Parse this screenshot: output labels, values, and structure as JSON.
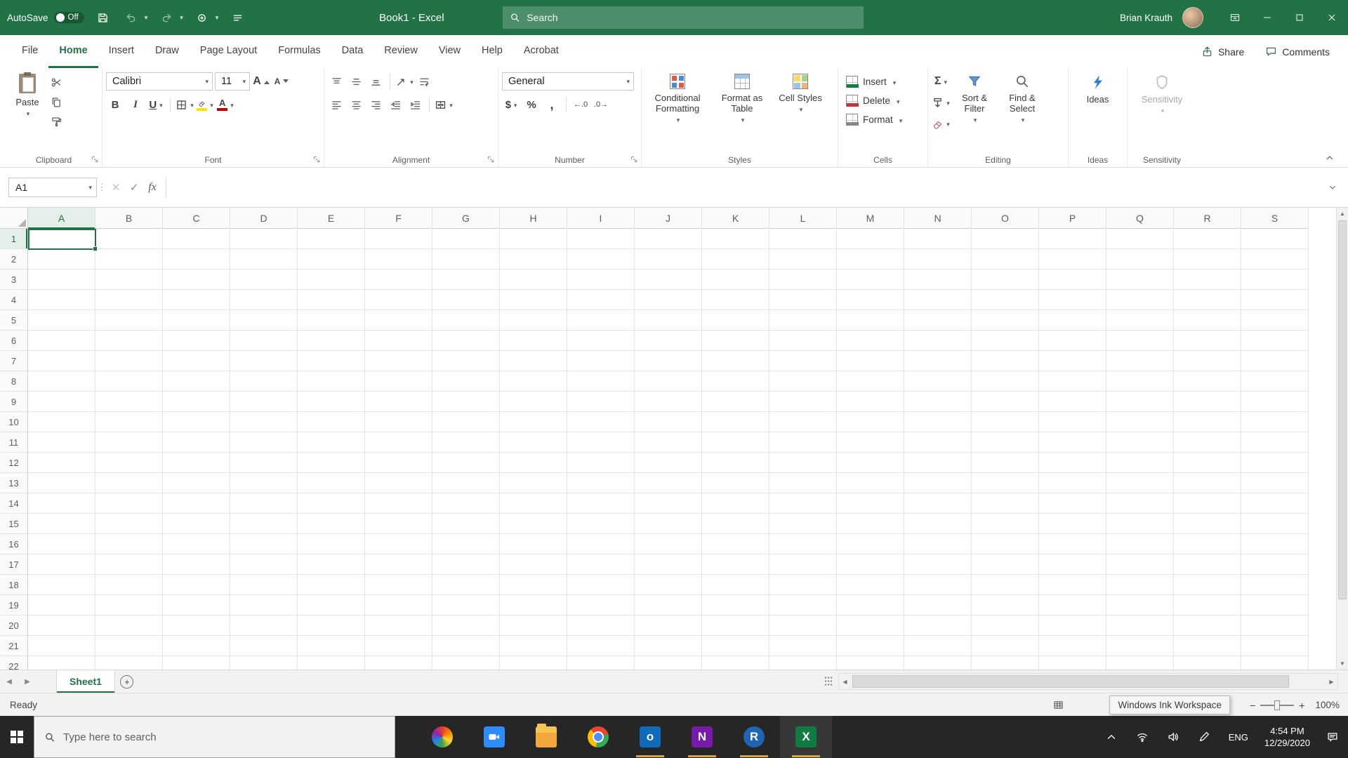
{
  "colors": {
    "excel_green": "#217346",
    "selection": "#217346",
    "taskbar": "#262626",
    "running_indicator": "#d9a23a",
    "fill_color_swatch": "#ffe400",
    "font_color_swatch": "#c00000"
  },
  "titlebar": {
    "autosave_label": "AutoSave",
    "autosave_state": "Off",
    "window_title": "Book1 - Excel",
    "search_placeholder": "Search",
    "user_name": "Brian Krauth"
  },
  "ribbon": {
    "tabs": [
      "File",
      "Home",
      "Insert",
      "Draw",
      "Page Layout",
      "Formulas",
      "Data",
      "Review",
      "View",
      "Help",
      "Acrobat"
    ],
    "active_tab": "Home",
    "share_label": "Share",
    "comments_label": "Comments",
    "clipboard": {
      "label": "Clipboard",
      "paste": "Paste"
    },
    "font": {
      "label": "Font",
      "font_name": "Calibri",
      "font_size": "11"
    },
    "alignment": {
      "label": "Alignment"
    },
    "number": {
      "label": "Number",
      "format": "General"
    },
    "styles": {
      "label": "Styles",
      "conditional": "Conditional Formatting",
      "format_table": "Format as Table",
      "cell_styles": "Cell Styles"
    },
    "cells": {
      "label": "Cells",
      "insert": "Insert",
      "delete": "Delete",
      "format": "Format"
    },
    "editing": {
      "label": "Editing",
      "sort_filter": "Sort & Filter",
      "find_select": "Find & Select"
    },
    "ideas": {
      "label": "Ideas",
      "button": "Ideas"
    },
    "sensitivity": {
      "label": "Sensitivity",
      "button": "Sensitivity"
    }
  },
  "glyphs": {
    "bold": "B",
    "italic": "I",
    "underline": "U",
    "dollar": "$",
    "percent": "%",
    "comma": ",",
    "increase_decimal": "←.0",
    "decrease_decimal": ".0→",
    "sigma": "Σ",
    "fx": "fx",
    "grow_font_letter": "A",
    "shrink_font_letter": "A",
    "font_color_letter": "A",
    "fill_letter": ""
  },
  "formula_bar": {
    "name_box": "A1"
  },
  "grid": {
    "columns": [
      "A",
      "B",
      "C",
      "D",
      "E",
      "F",
      "G",
      "H",
      "I",
      "J",
      "K",
      "L",
      "M",
      "N",
      "O",
      "P",
      "Q",
      "R",
      "S"
    ],
    "row_count": 22,
    "selected_cell": "A1"
  },
  "sheet_bar": {
    "tabs": [
      "Sheet1"
    ],
    "active_tab": "Sheet1"
  },
  "status_bar": {
    "mode": "Ready",
    "tooltip": "Windows Ink Workspace",
    "zoom": "100%"
  },
  "taskbar": {
    "search_placeholder": "Type here to search",
    "language": "ENG",
    "time": "4:54 PM",
    "date": "12/29/2020",
    "apps": [
      {
        "name": "openshot",
        "running": false
      },
      {
        "name": "zoom",
        "running": false,
        "bg": "#2d8cff",
        "svg": "s-camera"
      },
      {
        "name": "files",
        "running": false
      },
      {
        "name": "chrome",
        "running": false
      },
      {
        "name": "outlook",
        "running": true,
        "bg": "#0f6cbd",
        "glyph": "o"
      },
      {
        "name": "onenote",
        "running": true,
        "bg": "#7719aa",
        "glyph": "N"
      },
      {
        "name": "r-app",
        "running": true,
        "bg": "#2064b4",
        "glyph": "R"
      },
      {
        "name": "excel",
        "running": true,
        "bg": "#107c41",
        "glyph": "X"
      }
    ]
  }
}
